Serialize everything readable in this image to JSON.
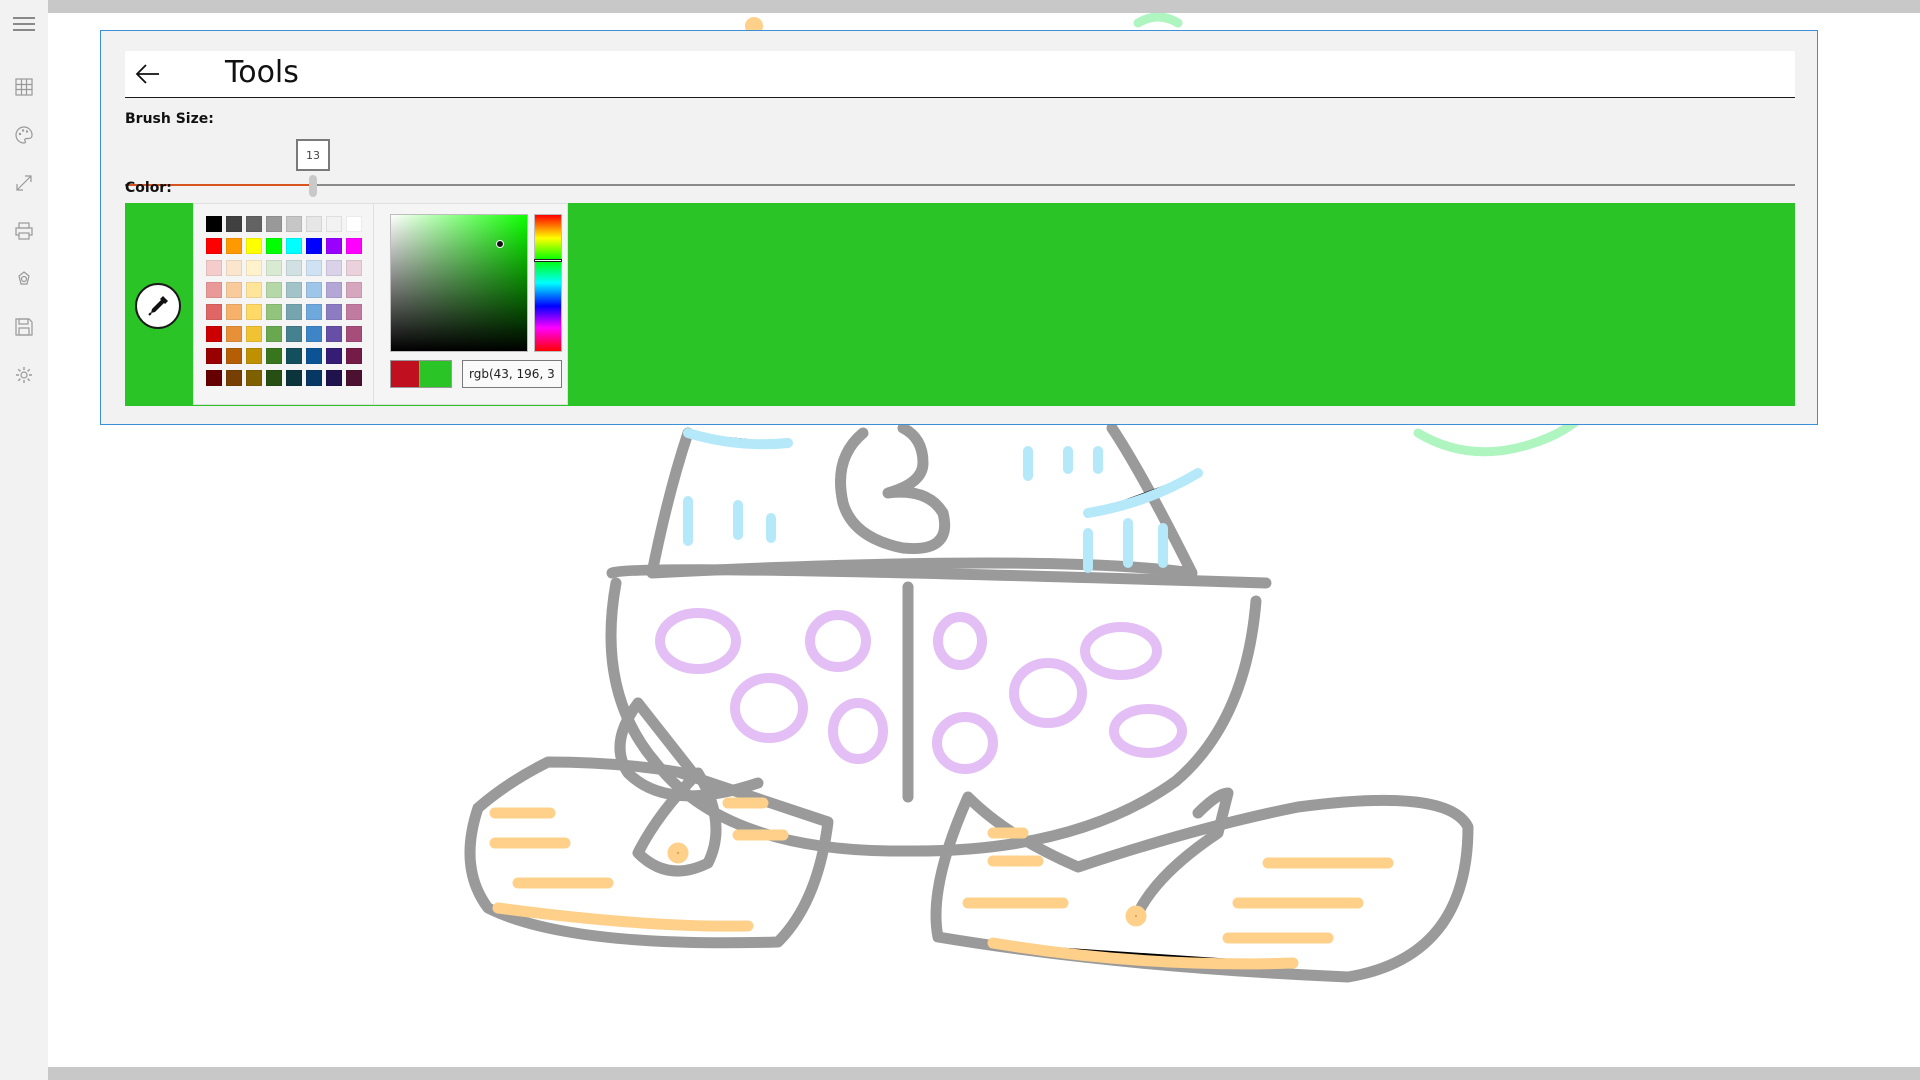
{
  "app": {
    "sidebar": {
      "items": [
        {
          "name": "hamburger-menu"
        },
        {
          "name": "grid"
        },
        {
          "name": "palette"
        },
        {
          "name": "expand"
        },
        {
          "name": "print"
        },
        {
          "name": "shapes"
        },
        {
          "name": "save"
        },
        {
          "name": "settings"
        }
      ]
    }
  },
  "tools_panel": {
    "title": "Tools",
    "brush_size_label": "Brush Size:",
    "brush_size_value": "13",
    "brush_size_min": 1,
    "brush_size_max": 100,
    "color_label": "Color:"
  },
  "color_picker": {
    "selected_color": "#2bc426",
    "previous_color": "#c0101f",
    "value_text": "rgb(43, 196, 3",
    "hue_degrees": 117,
    "palette_rows": [
      [
        "#000000",
        "#404040",
        "#636363",
        "#999999",
        "#c6c6c6",
        "#e6e6e6",
        "#f2f2f2",
        "#ffffff"
      ],
      [
        "#ff0000",
        "#ff9900",
        "#ffff00",
        "#00ff00",
        "#00ffff",
        "#0000ff",
        "#9900ff",
        "#ff00ff"
      ],
      [
        "#f4cccc",
        "#fce5cd",
        "#fff2cc",
        "#d9ead3",
        "#d0e0e3",
        "#cfe2f3",
        "#d9d2e9",
        "#ead1dc"
      ],
      [
        "#ea9999",
        "#f9cb9c",
        "#ffe599",
        "#b6d7a8",
        "#a2c4c9",
        "#9fc5e8",
        "#b4a7d6",
        "#d5a6bd"
      ],
      [
        "#e06666",
        "#f6b26b",
        "#ffd966",
        "#93c47d",
        "#76a5af",
        "#6fa8dc",
        "#8e7cc3",
        "#c27ba0"
      ],
      [
        "#cc0000",
        "#e69138",
        "#f1c232",
        "#6aa84f",
        "#45818e",
        "#3d85c6",
        "#674ea7",
        "#a64d79"
      ],
      [
        "#990000",
        "#b45f06",
        "#bf9000",
        "#38761d",
        "#134f5c",
        "#0b5394",
        "#351c75",
        "#741b47"
      ],
      [
        "#660000",
        "#783f04",
        "#7f6000",
        "#274e13",
        "#0c343d",
        "#073763",
        "#20124d",
        "#4c1130"
      ]
    ]
  }
}
